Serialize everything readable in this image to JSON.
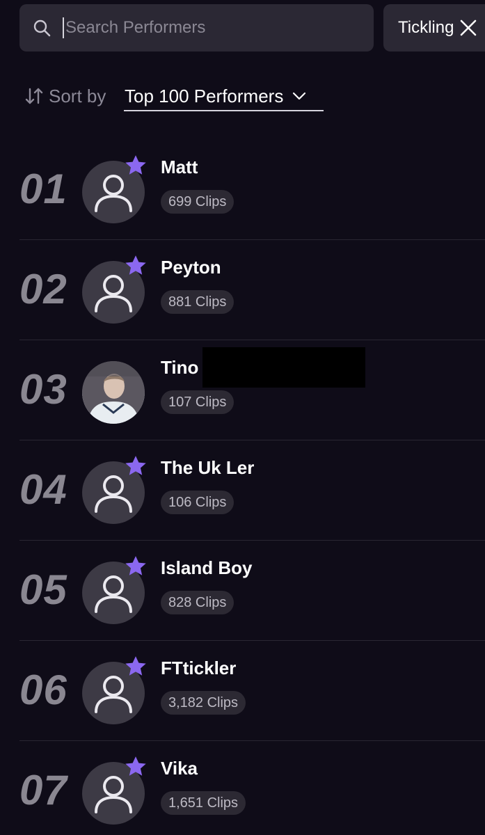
{
  "search": {
    "placeholder": "Search Performers",
    "value": ""
  },
  "filter_chip": {
    "label": "Tickling"
  },
  "sort": {
    "label": "Sort by",
    "selected": "Top 100 Performers"
  },
  "performers": [
    {
      "rank": "01",
      "name": "Matt",
      "clips": "699 Clips",
      "verified": true
    },
    {
      "rank": "02",
      "name": "Peyton",
      "clips": "881 Clips",
      "verified": true
    },
    {
      "rank": "03",
      "name": "Tino",
      "clips": "107 Clips",
      "verified": false
    },
    {
      "rank": "04",
      "name": "The Uk Ler",
      "clips": "106 Clips",
      "verified": true
    },
    {
      "rank": "05",
      "name": "Island Boy",
      "clips": "828 Clips",
      "verified": true
    },
    {
      "rank": "06",
      "name": "FTtickler",
      "clips": "3,182 Clips",
      "verified": true
    },
    {
      "rank": "07",
      "name": "Vika",
      "clips": "1,651 Clips",
      "verified": true
    }
  ],
  "icons": {
    "search": "search-icon",
    "close": "close-icon",
    "sort": "sort-arrows-icon",
    "chevron": "chevron-down-icon",
    "avatar": "person-icon",
    "verified": "star-icon"
  },
  "colors": {
    "background": "#0f0c18",
    "surface": "#2b2834",
    "accent_star": "#8b68f0",
    "rank_text": "#8a8791"
  }
}
